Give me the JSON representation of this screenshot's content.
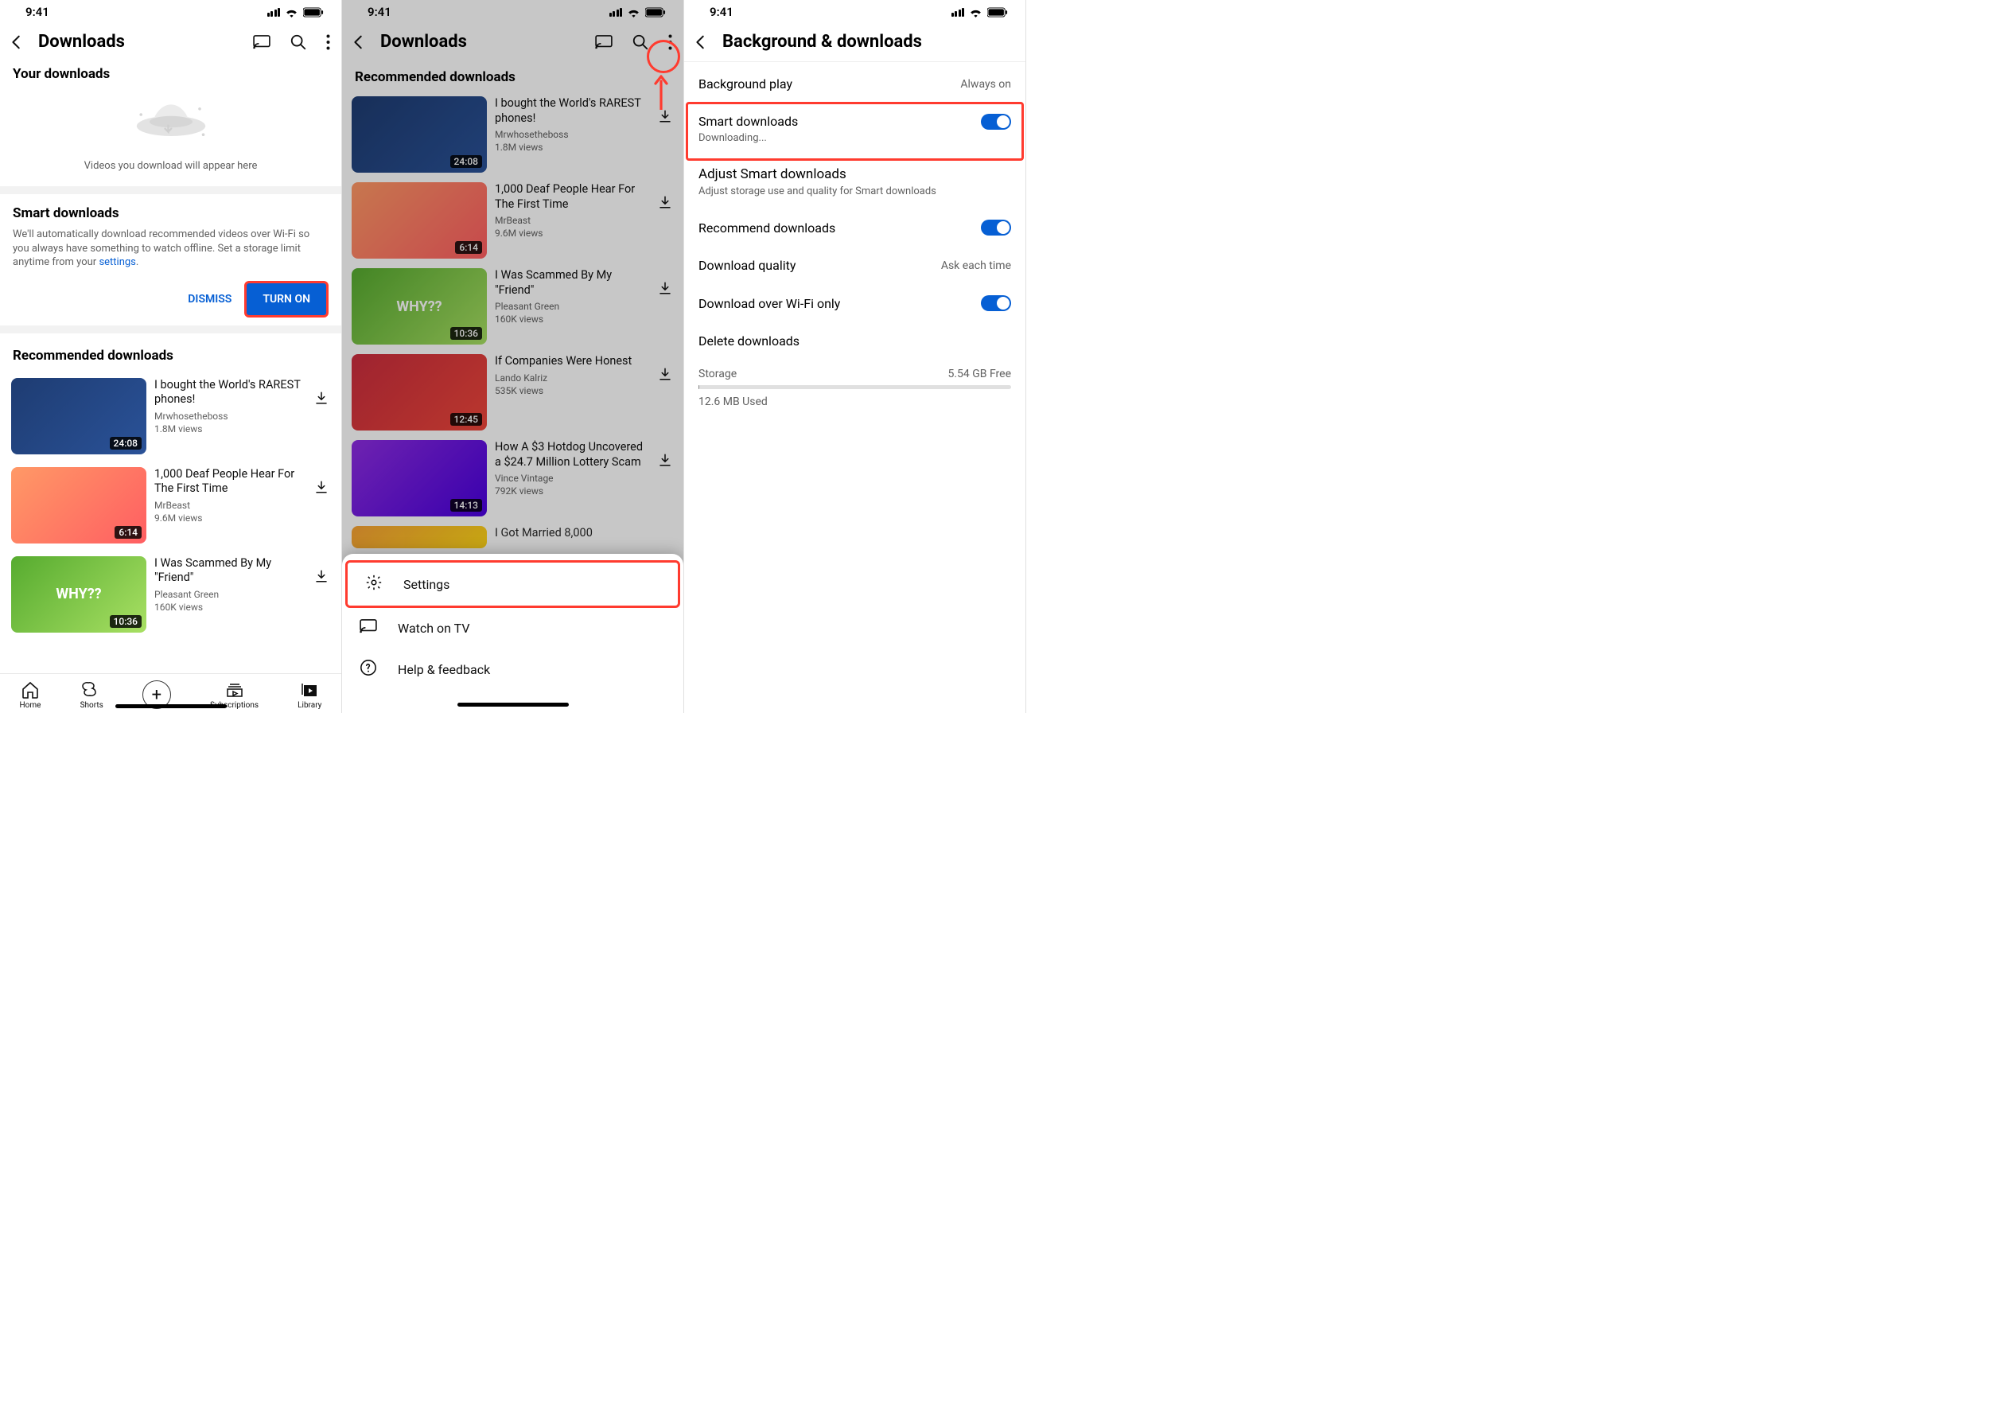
{
  "status": {
    "time": "9:41"
  },
  "panel1": {
    "title": "Downloads",
    "your_downloads": "Your downloads",
    "empty_msg": "Videos you download will appear here",
    "smart": {
      "title": "Smart downloads",
      "desc_pre": "We'll automatically download recommended videos over Wi-Fi so you always have something to watch offline. Set a storage limit anytime from your ",
      "settings_link": "settings",
      "desc_post": ".",
      "dismiss": "DISMISS",
      "turn_on": "TURN ON"
    },
    "recommended_title": "Recommended downloads",
    "videos": [
      {
        "title": "I bought the World's RAREST phones!",
        "channel": "Mrwhosetheboss",
        "views": "1.8M views",
        "duration": "24:08"
      },
      {
        "title": "1,000 Deaf People Hear For The First Time",
        "channel": "MrBeast",
        "views": "9.6M views",
        "duration": "6:14"
      },
      {
        "title": "I Was Scammed By My \"Friend\"",
        "channel": "Pleasant Green",
        "views": "160K views",
        "duration": "10:36"
      }
    ],
    "tabs": {
      "home": "Home",
      "shorts": "Shorts",
      "subs": "Subscriptions",
      "library": "Library"
    }
  },
  "panel2": {
    "title": "Downloads",
    "recommended_title": "Recommended downloads",
    "videos": [
      {
        "title": "I bought the World's RAREST phones!",
        "channel": "Mrwhosetheboss",
        "views": "1.8M views",
        "duration": "24:08"
      },
      {
        "title": "1,000 Deaf People Hear For The First Time",
        "channel": "MrBeast",
        "views": "9.6M views",
        "duration": "6:14"
      },
      {
        "title": "I Was Scammed By My \"Friend\"",
        "channel": "Pleasant Green",
        "views": "160K views",
        "duration": "10:36"
      },
      {
        "title": "If Companies Were Honest",
        "channel": "Lando Kalriz",
        "views": "535K views",
        "duration": "12:45"
      },
      {
        "title": "How A $3 Hotdog Uncovered a $24.7 Million Lottery Scam",
        "channel": "Vince Vintage",
        "views": "792K views",
        "duration": "14:13"
      },
      {
        "title": "I Got Married 8,000",
        "channel": "",
        "views": "",
        "duration": ""
      }
    ],
    "sheet": {
      "settings": "Settings",
      "watch_tv": "Watch on TV",
      "help": "Help & feedback"
    }
  },
  "panel3": {
    "title": "Background & downloads",
    "rows": {
      "bg_play": {
        "label": "Background play",
        "value": "Always on"
      },
      "smart": {
        "label": "Smart downloads",
        "sub": "Downloading..."
      },
      "adjust": {
        "label": "Adjust Smart downloads",
        "sub": "Adjust storage use and quality for Smart downloads"
      },
      "recommend": {
        "label": "Recommend downloads"
      },
      "quality": {
        "label": "Download quality",
        "value": "Ask each time"
      },
      "wifi": {
        "label": "Download over Wi-Fi only"
      },
      "delete": {
        "label": "Delete downloads"
      }
    },
    "storage": {
      "label": "Storage",
      "free": "5.54 GB Free",
      "used": "12.6 MB Used"
    }
  }
}
